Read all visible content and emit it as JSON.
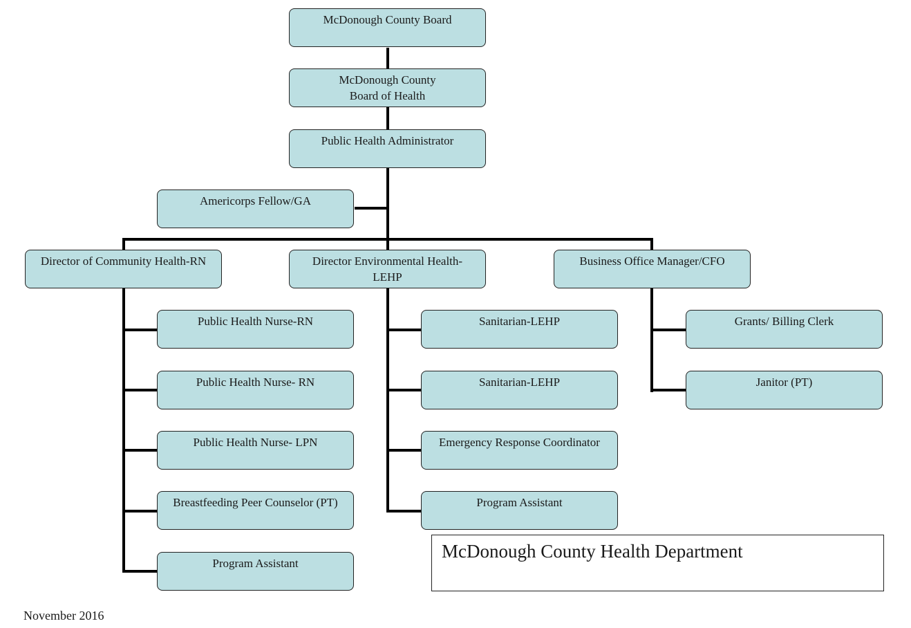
{
  "chart": {
    "title": "McDonough County Health Department",
    "date": "November 2016",
    "box_color": "#bcdfe2",
    "nodes": {
      "county_board": "McDonough County Board",
      "board_of_health_line1": "McDonough County",
      "board_of_health_line2": "Board of Health",
      "administrator": "Public Health Administrator",
      "americorps": "Americorps Fellow/GA",
      "dir_community": "Director of Community Health-RN",
      "dir_env_line1": "Director Environmental Health-",
      "dir_env_line2": "LEHP",
      "business_mgr": "Business Office Manager/CFO"
    },
    "community_staff": [
      "Public Health Nurse-RN",
      "Public Health Nurse- RN",
      "Public Health Nurse- LPN",
      "Breastfeeding Peer Counselor (PT)",
      "Program Assistant"
    ],
    "environmental_staff": [
      "Sanitarian-LEHP",
      "Sanitarian-LEHP",
      "Emergency Response Coordinator",
      "Program Assistant"
    ],
    "business_staff": [
      "Grants/ Billing Clerk",
      "Janitor (PT)"
    ]
  }
}
